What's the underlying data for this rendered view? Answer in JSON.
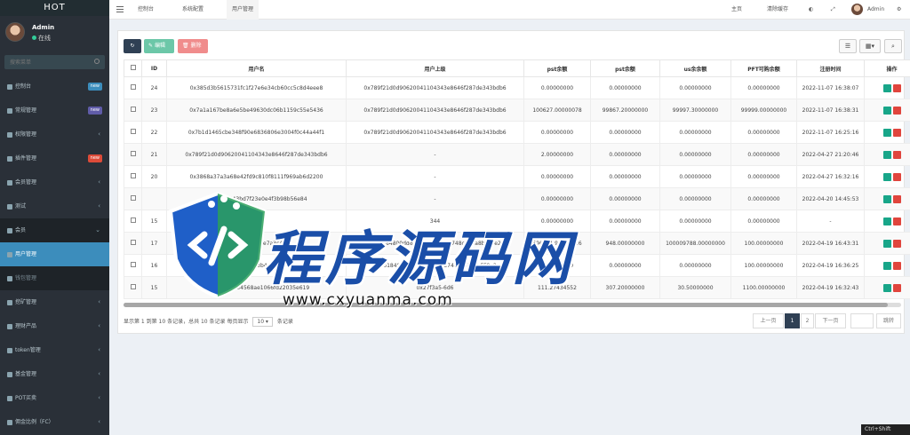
{
  "brand": "HOT",
  "user": {
    "name": "Admin",
    "status": "在线"
  },
  "search_placeholder": "搜索菜单",
  "sidebar": [
    {
      "label": "控制台",
      "badge": "new",
      "badge_color": "#3c8dbc"
    },
    {
      "label": "常规管理",
      "badge": "new",
      "badge_color": "#605ca8"
    },
    {
      "label": "权限管理",
      "chevron": "‹"
    },
    {
      "label": "插件管理",
      "badge": "new",
      "badge_color": "#dd4b39"
    },
    {
      "label": "会员管理",
      "chevron": "‹"
    },
    {
      "label": "测试",
      "chevron": "‹"
    },
    {
      "label": "会员",
      "chevron": "⌄"
    },
    {
      "label": "用户管理"
    },
    {
      "label": "钱包管理"
    },
    {
      "label": "挖矿管理",
      "chevron": "‹"
    },
    {
      "label": "理财产品",
      "chevron": "‹"
    },
    {
      "label": "token管理",
      "chevron": "‹"
    },
    {
      "label": "基金管理",
      "chevron": "‹"
    },
    {
      "label": "POT买卖",
      "chevron": "‹"
    },
    {
      "label": "佣金比例（FC）",
      "chevron": "‹"
    }
  ],
  "top_tabs": [
    "控制台",
    "系统配置",
    "用户管理"
  ],
  "top_right": {
    "home": "主页",
    "clear_cache": "清除缓存",
    "admin": "Admin"
  },
  "toolbar": {
    "edit": "编辑",
    "delete": "删除"
  },
  "table": {
    "columns": [
      "ID",
      "用户名",
      "用户上级",
      "pst余额",
      "pst余额",
      "us余余额",
      "PFT可购余额",
      "注册时间",
      "操作"
    ],
    "rows": [
      [
        "24",
        "0x385d3b5615731fc1f27e6e34cb60cc5c8d4eee8",
        "0x789f21d0d90620041104343e8646f287de343bdb6",
        "0.00000000",
        "0.00000000",
        "0.00000000",
        "0.00000000",
        "2022-11-07 16:38:07"
      ],
      [
        "23",
        "0x7a1a167be8a6e5be49630dc06b1159c55e5436",
        "0x789f21d0d90620041104343e8646f287de343bdb6",
        "100627.00000078",
        "99867.20000000",
        "99997.30000000",
        "99999.00000000",
        "2022-11-07 16:38:31"
      ],
      [
        "22",
        "0x7b1d1465cbe348f90e6836806e3004f0c44a44f1",
        "0x789f21d0d90620041104343e8646f287de343bdb6",
        "0.00000000",
        "0.00000000",
        "0.00000000",
        "0.00000000",
        "2022-11-07 16:25:16"
      ],
      [
        "21",
        "0x789f21d0d90620041104343e8646f287de343bdb6",
        "-",
        "2.00000000",
        "0.00000000",
        "0.00000000",
        "0.00000000",
        "2022-04-27 21:20:46"
      ],
      [
        "20",
        "0x3868a37a3a68e42fd9c810f8111f969ab6d2200",
        "-",
        "0.00000000",
        "0.00000000",
        "0.00000000",
        "0.00000000",
        "2022-04-27 16:32:16"
      ],
      [
        "",
        "0x5a4b8243bd7f23e0e4f3b98b56e84",
        "-",
        "0.00000000",
        "0.00000000",
        "0.00000000",
        "0.00000000",
        "2022-04-20 14:45:53"
      ],
      [
        "15",
        "",
        "344",
        "0.00000000",
        "0.00000000",
        "0.00000000",
        "0.00000000",
        "-"
      ],
      [
        "17",
        "0x3a8ce97f8e7a3c4f",
        "0x26184800dd60941f24c0d63748cb62a8bFF8e2",
        "596471.96363426",
        "948.00000000",
        "100009788.00000000",
        "100.00000000",
        "2022-04-19 16:43:31"
      ],
      [
        "16",
        "0x72a35d3b4831f9",
        "0x26184800dd6094ac0d63748cb62a8bFF8e2",
        "0.00000000",
        "0.00000000",
        "0.00000000",
        "100.00000000",
        "2022-04-19 16:36:25"
      ],
      [
        "15",
        "0xab8e1942e4568ae1066fd22035e619",
        "0x27f3a5-6d6",
        "111.27434552",
        "307.20000000",
        "30.50000000",
        "1100.00000000",
        "2022-04-19 16:32:43"
      ]
    ]
  },
  "pager": {
    "info_prefix": "显示第 1 到第 10 条记录，总共 10 条记录 每页显示",
    "page_size": "10",
    "info_suffix": "条记录",
    "prev": "上一页",
    "pages": [
      "1",
      "2"
    ],
    "next": "下一页",
    "goto": "跳转"
  },
  "watermark": {
    "text": "程序源码网",
    "url": "www.cxyuanma.com"
  },
  "corner_label": "Ctrl+Shift"
}
